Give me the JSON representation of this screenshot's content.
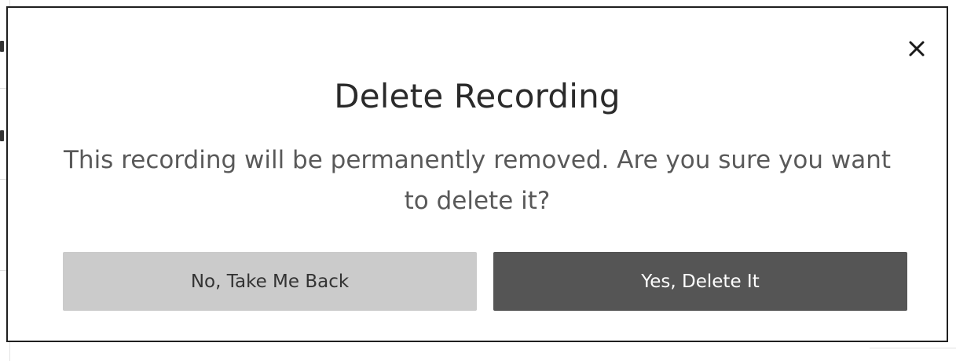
{
  "dialog": {
    "title": "Delete Recording",
    "message": "This recording will be permanently removed. Are you sure you want to delete it?",
    "close_icon": "close-icon",
    "buttons": {
      "cancel_label": "No, Take Me Back",
      "confirm_label": "Yes, Delete It"
    }
  },
  "colors": {
    "cancel_bg": "#cbcbcb",
    "confirm_bg": "#555555",
    "title_text": "#2a2a2a",
    "message_text": "#595959"
  }
}
